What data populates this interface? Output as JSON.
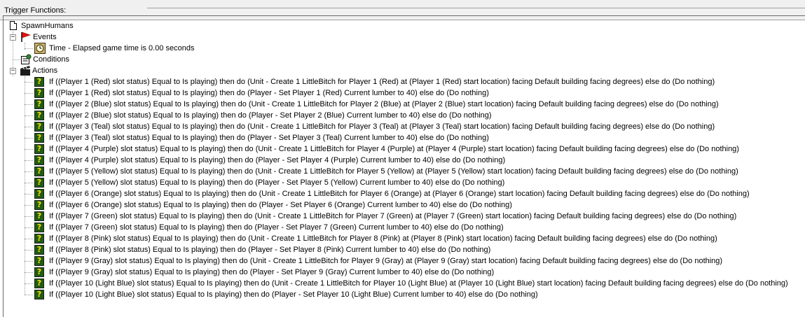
{
  "panel": {
    "title": "Trigger Functions:"
  },
  "trigger": {
    "name": "SpawnHumans"
  },
  "events": {
    "label": "Events",
    "items": [
      "Time - Elapsed game time is 0.00 seconds"
    ]
  },
  "conditions": {
    "label": "Conditions"
  },
  "actions": {
    "label": "Actions",
    "items": [
      "If ((Player 1 (Red) slot status) Equal to Is playing) then do (Unit - Create 1 LittleBitch for Player 1 (Red) at (Player 1 (Red) start location) facing Default building facing degrees) else do (Do nothing)",
      "If ((Player 1 (Red) slot status) Equal to Is playing) then do (Player - Set Player 1 (Red) Current lumber to 40) else do (Do nothing)",
      "If ((Player 2 (Blue) slot status) Equal to Is playing) then do (Unit - Create 1 LittleBitch for Player 2 (Blue) at (Player 2 (Blue) start location) facing Default building facing degrees) else do (Do nothing)",
      "If ((Player 2 (Blue) slot status) Equal to Is playing) then do (Player - Set Player 2 (Blue) Current lumber to 40) else do (Do nothing)",
      "If ((Player 3 (Teal) slot status) Equal to Is playing) then do (Unit - Create 1 LittleBitch for Player 3 (Teal) at (Player 3 (Teal) start location) facing Default building facing degrees) else do (Do nothing)",
      "If ((Player 3 (Teal) slot status) Equal to Is playing) then do (Player - Set Player 3 (Teal) Current lumber to 40) else do (Do nothing)",
      "If ((Player 4 (Purple) slot status) Equal to Is playing) then do (Unit - Create 1 LittleBitch for Player 4 (Purple) at (Player 4 (Purple) start location) facing Default building facing degrees) else do (Do nothing)",
      "If ((Player 4 (Purple) slot status) Equal to Is playing) then do (Player - Set Player 4 (Purple) Current lumber to 40) else do (Do nothing)",
      "If ((Player 5 (Yellow) slot status) Equal to Is playing) then do (Unit - Create 1 LittleBitch for Player 5 (Yellow) at (Player 5 (Yellow) start location) facing Default building facing degrees) else do (Do nothing)",
      "If ((Player 5 (Yellow) slot status) Equal to Is playing) then do (Player - Set Player 5 (Yellow) Current lumber to 40) else do (Do nothing)",
      "If ((Player 6 (Orange) slot status) Equal to Is playing) then do (Unit - Create 1 LittleBitch for Player 6 (Orange) at (Player 6 (Orange) start location) facing Default building facing degrees) else do (Do nothing)",
      "If ((Player 6 (Orange) slot status) Equal to Is playing) then do (Player - Set Player 6 (Orange) Current lumber to 40) else do (Do nothing)",
      "If ((Player 7 (Green) slot status) Equal to Is playing) then do (Unit - Create 1 LittleBitch for Player 7 (Green) at (Player 7 (Green) start location) facing Default building facing degrees) else do (Do nothing)",
      "If ((Player 7 (Green) slot status) Equal to Is playing) then do (Player - Set Player 7 (Green) Current lumber to 40) else do (Do nothing)",
      "If ((Player 8 (Pink) slot status) Equal to Is playing) then do (Unit - Create 1 LittleBitch for Player 8 (Pink) at (Player 8 (Pink) start location) facing Default building facing degrees) else do (Do nothing)",
      "If ((Player 8 (Pink) slot status) Equal to Is playing) then do (Player - Set Player 8 (Pink) Current lumber to 40) else do (Do nothing)",
      "If ((Player 9 (Gray) slot status) Equal to Is playing) then do (Unit - Create 1 LittleBitch for Player 9 (Gray) at (Player 9 (Gray) start location) facing Default building facing degrees) else do (Do nothing)",
      "If ((Player 9 (Gray) slot status) Equal to Is playing) then do (Player - Set Player 9 (Gray) Current lumber to 40) else do (Do nothing)",
      "If ((Player 10 (Light Blue) slot status) Equal to Is playing) then do (Unit - Create 1 LittleBitch for Player 10 (Light Blue) at (Player 10 (Light Blue) start location) facing Default building facing degrees) else do (Do nothing)",
      "If ((Player 10 (Light Blue) slot status) Equal to Is playing) then do (Player - Set Player 10 (Light Blue) Current lumber to 40) else do (Do nothing)"
    ]
  },
  "icons": {
    "trigger": "document-icon",
    "events": "red-flag-icon",
    "event_item": "clock-icon",
    "conditions": "conditions-icon",
    "actions": "clapperboard-icon",
    "action_item": "green-question-icon"
  },
  "colors": {
    "panel_bg": "#f0f0f0",
    "action_icon_bg": "#1f5c14",
    "action_icon_glyph": "#ffe600",
    "flag_red": "#e11212"
  }
}
